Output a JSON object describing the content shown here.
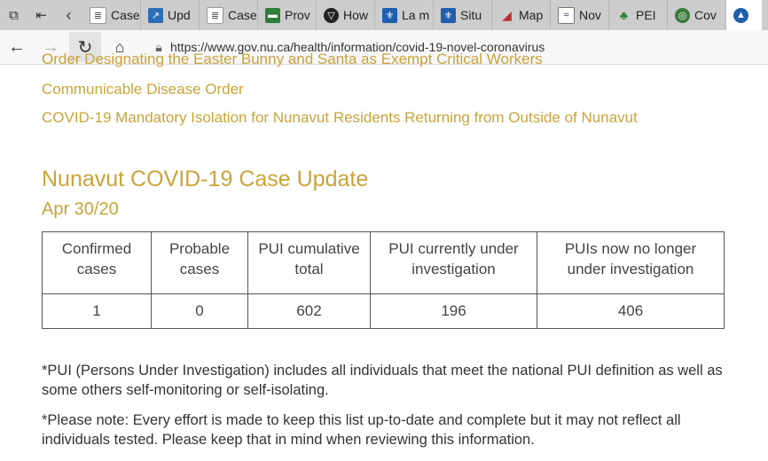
{
  "tabs": [
    {
      "label": "Case",
      "icon": "page-icon",
      "color": "#ffffff"
    },
    {
      "label": "Upd",
      "icon": "chart-icon",
      "color": "#2a6fb5"
    },
    {
      "label": "Case",
      "icon": "page-icon",
      "color": "#ffffff"
    },
    {
      "label": "Prov",
      "icon": "flag-icon",
      "color": "#2e7d3a"
    },
    {
      "label": "How",
      "icon": "shield-icon",
      "color": "#222222"
    },
    {
      "label": "La m",
      "icon": "fleur-icon",
      "color": "#1f5fae"
    },
    {
      "label": "Situ",
      "icon": "fleur-icon",
      "color": "#1f5fae"
    },
    {
      "label": "Map",
      "icon": "map-icon",
      "color": "#ffffff"
    },
    {
      "label": "Nov",
      "icon": "nova-icon",
      "color": "#ffffff"
    },
    {
      "label": "PEI",
      "icon": "pei-icon",
      "color": "#ffffff"
    },
    {
      "label": "Cov",
      "icon": "globe-icon",
      "color": "#ffffff"
    }
  ],
  "address": {
    "url": "https://www.gov.nu.ca/health/information/covid-19-novel-coronavirus"
  },
  "links": {
    "partial": "Order Designating the Easter Bunny and Santa as Exempt Critical Workers",
    "communicable": "Communicable Disease Order",
    "isolation": "COVID-19 Mandatory Isolation for Nunavut Residents Returning from Outside of Nunavut"
  },
  "heading": "Nunavut COVID-19 Case Update",
  "date": "Apr 30/20",
  "table": {
    "headers": [
      "Confirmed cases",
      "Probable cases",
      "PUI cumulative total",
      "PUI currently under investigation",
      "PUIs now no longer under investigation"
    ],
    "values": [
      "1",
      "0",
      "602",
      "196",
      "406"
    ]
  },
  "notes": {
    "pui": "*PUI (Persons Under Investigation) includes all individuals that meet the national PUI definition as well as some others self-monitoring or self-isolating.",
    "please": "*Please note: Every effort is made to keep this list up-to-date and complete but it may not reflect all individuals tested. Please keep that in mind when reviewing this information."
  },
  "colors": {
    "accent": "#c9a43a",
    "text": "#333333"
  }
}
